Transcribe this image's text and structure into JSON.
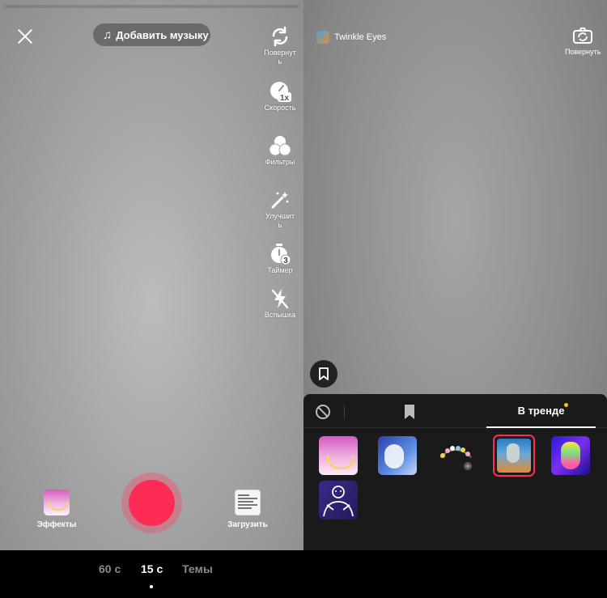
{
  "left": {
    "add_music_label": "Добавить музыку",
    "tools": [
      {
        "icon": "rotate-icon",
        "label": "Повернуть"
      },
      {
        "icon": "speed-icon",
        "label": "Скорость",
        "badge": "1x"
      },
      {
        "icon": "filters-icon",
        "label": "Фильтры"
      },
      {
        "icon": "enhance-icon",
        "label": "Улучшить"
      },
      {
        "icon": "timer-icon",
        "label": "Таймер",
        "badge": "3"
      },
      {
        "icon": "flash-off-icon",
        "label": "Вспышка"
      }
    ],
    "effects_label": "Эффекты",
    "upload_label": "Загрузить"
  },
  "right": {
    "effect_name": "Twinkle Eyes",
    "flip_label": "Повернуть",
    "tabs": {
      "trending_label": "В тренде"
    },
    "effects": [
      {
        "icon": "necklace-effect-icon"
      },
      {
        "icon": "portrait-frame-effect-icon"
      },
      {
        "icon": "flower-crown-effect-icon"
      },
      {
        "icon": "twinkle-eyes-effect-icon",
        "selected": true
      },
      {
        "icon": "neon-mask-effect-icon"
      },
      {
        "icon": "outline-figure-effect-icon"
      }
    ]
  },
  "bottom": {
    "modes": [
      "60 с",
      "15 с",
      "Темы"
    ],
    "active_mode": "15 с"
  },
  "colors": {
    "record": "#fe2c55",
    "selected_border": "#fe2c55",
    "badge_dot": "#f4c21b",
    "tray_bg": "#1a1a1a"
  }
}
